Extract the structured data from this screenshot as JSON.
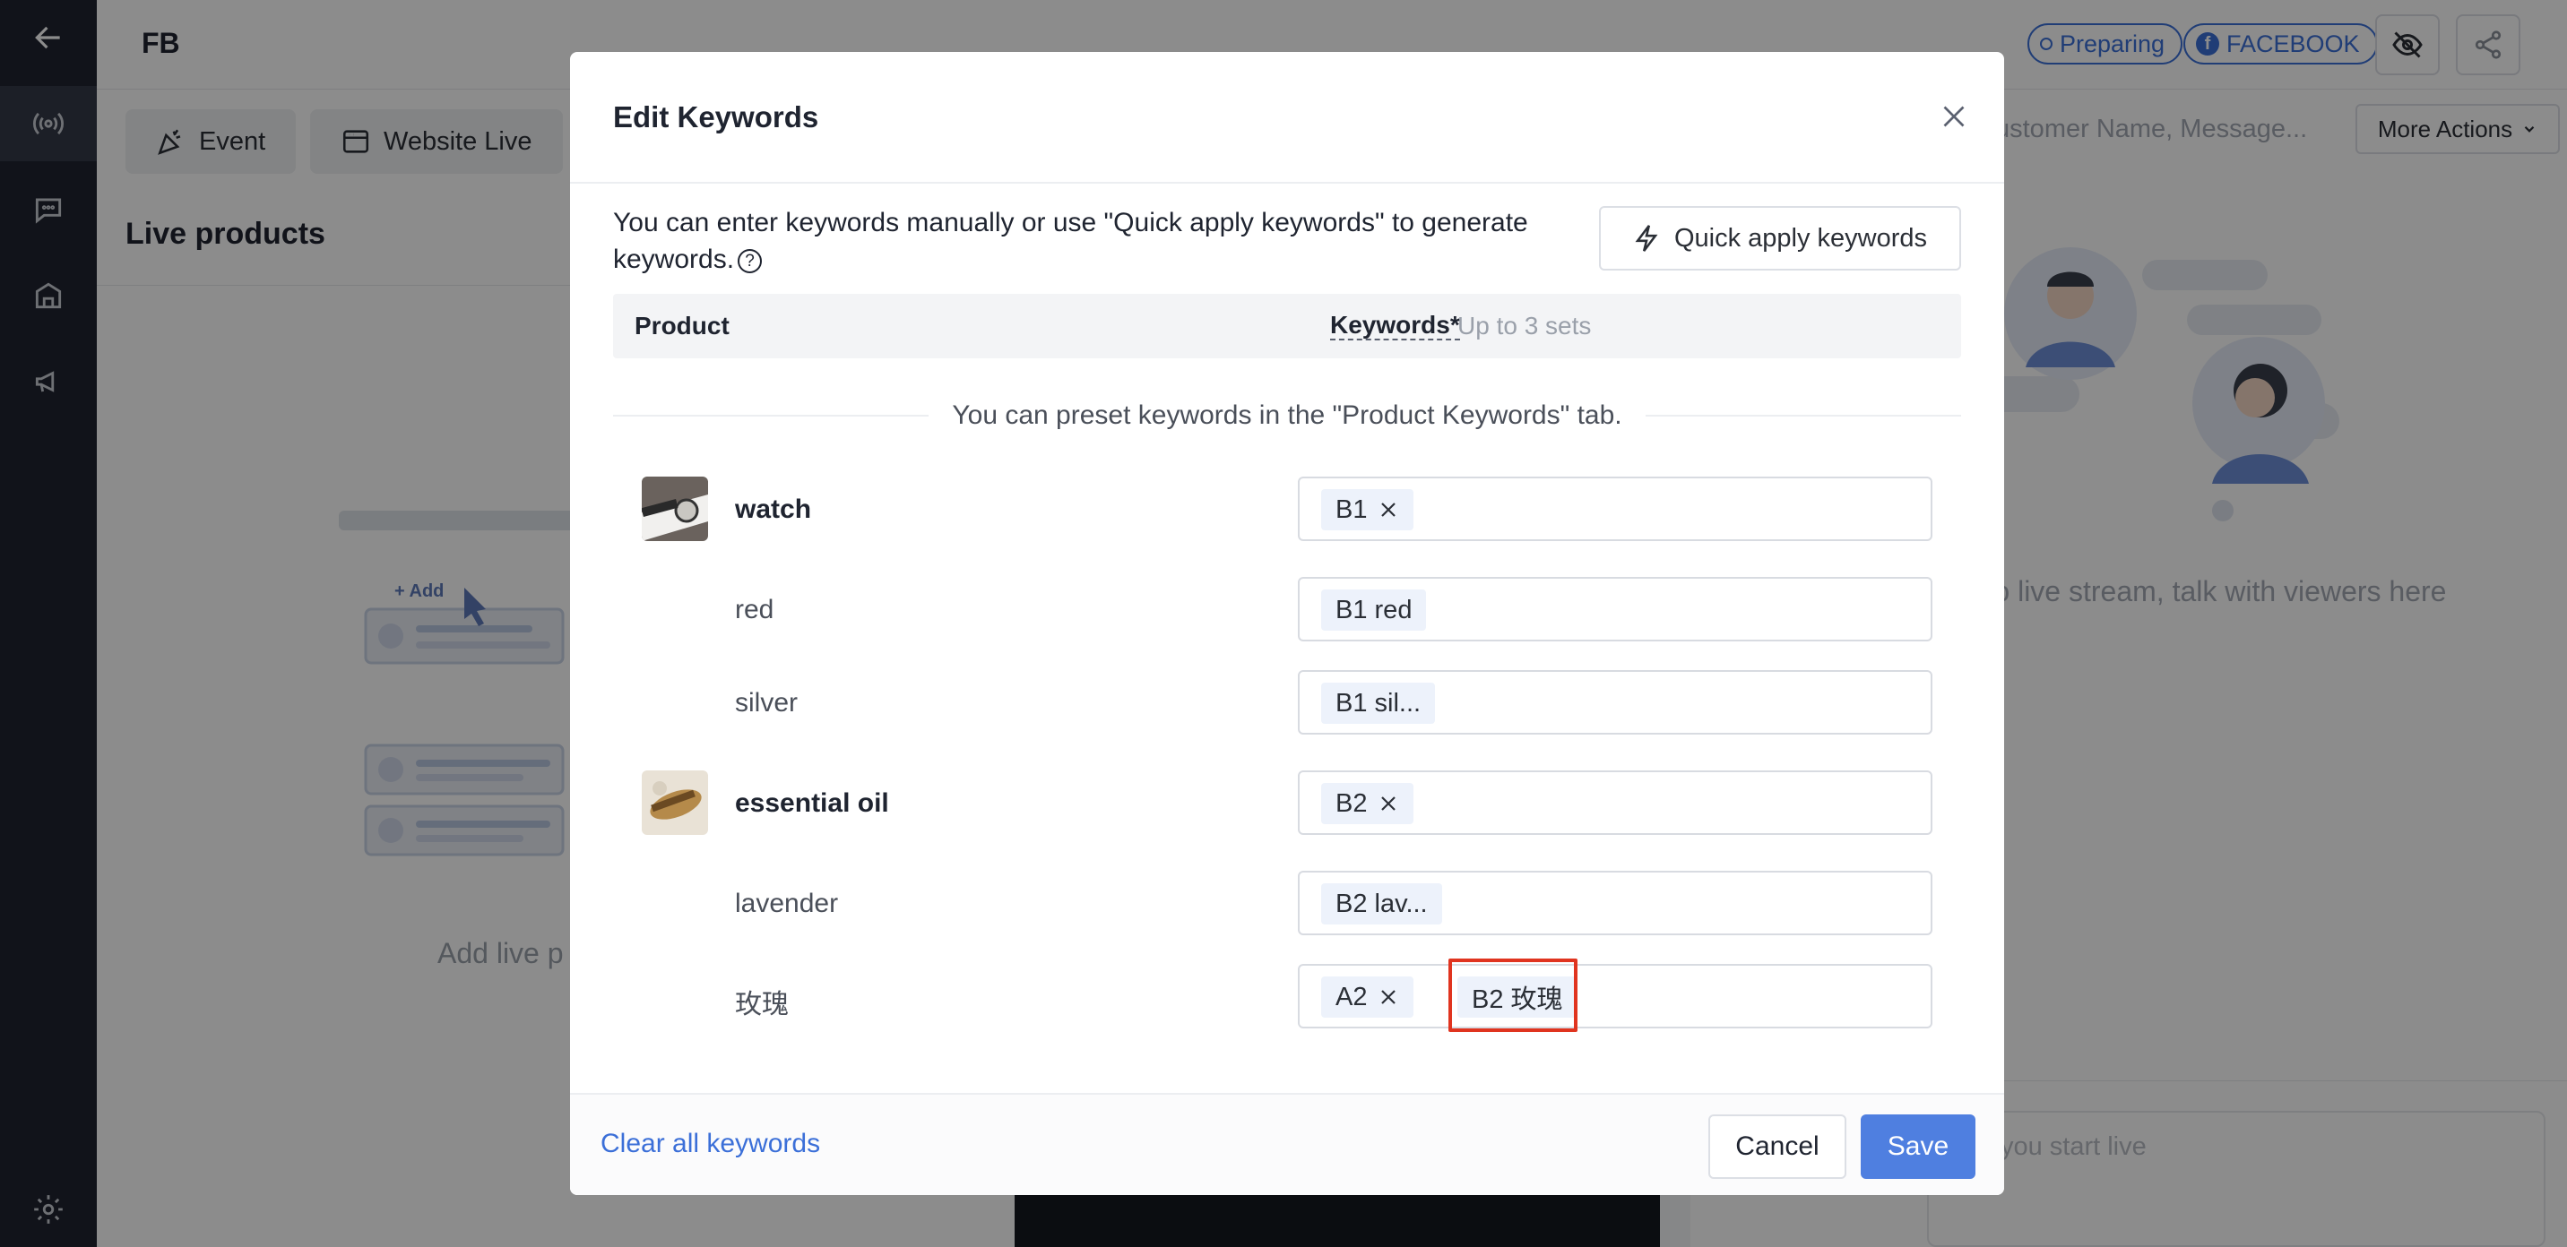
{
  "app": {
    "title": "FB",
    "status_label": "Preparing",
    "platform_label": "FACEBOOK",
    "platform_icon": "f",
    "tabs": [
      {
        "label": "Event",
        "icon": "party-icon"
      },
      {
        "label": "Website Live",
        "icon": "browser-icon"
      }
    ],
    "left_title": "Live products",
    "left_empty": "Add live p",
    "illus_add_label": "+ Add",
    "search_placeholder": "ustomer Name, Message...",
    "more_actions": "More Actions",
    "right_empty": "nected to live stream, talk with viewers here",
    "comment_placeholder": "fter you start live"
  },
  "modal": {
    "title": "Edit Keywords",
    "intro": "You can enter keywords manually or use \"Quick apply keywords\" to generate keywords.",
    "help_glyph": "?",
    "quick_apply": "Quick apply keywords",
    "col_product": "Product",
    "col_keywords": "Keywords*",
    "col_hint": "Up to 3 sets",
    "preset_note": "You can preset keywords in the \"Product Keywords\" tab.",
    "rows": [
      {
        "name": "watch",
        "tags": [
          {
            "text": "B1",
            "removable": true
          }
        ]
      },
      {
        "name": "red",
        "tags": [
          {
            "text": "B1 red",
            "removable": false
          }
        ]
      },
      {
        "name": "silver",
        "tags": [
          {
            "text": "B1 sil...",
            "removable": false
          }
        ]
      },
      {
        "name": "essential oil",
        "tags": [
          {
            "text": "B2",
            "removable": true
          }
        ]
      },
      {
        "name": "lavender",
        "tags": [
          {
            "text": "B2 lav...",
            "removable": false
          }
        ]
      },
      {
        "name": "玫瑰",
        "tags": [
          {
            "text": "A2",
            "removable": true
          },
          {
            "text": "B2 玫瑰",
            "removable": false
          }
        ]
      }
    ],
    "clear_all": "Clear all keywords",
    "cancel": "Cancel",
    "save": "Save"
  },
  "colors": {
    "accent": "#4f7fe0",
    "link": "#3b6fd8",
    "highlight": "#e0341f",
    "sidebar": "#1f2430"
  }
}
